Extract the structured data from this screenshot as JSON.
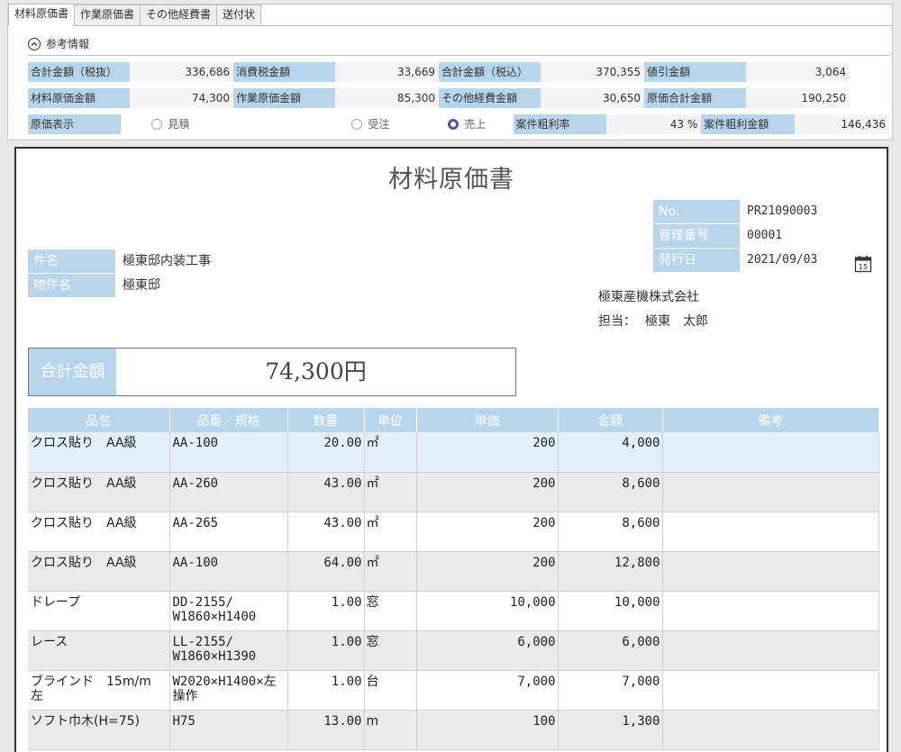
{
  "tabs": [
    "材料原価書",
    "作業原価書",
    "その他経費書",
    "送付状"
  ],
  "reference": {
    "title": "参考情報",
    "rows": [
      [
        {
          "label": "合計金額（税抜）",
          "value": "336,686"
        },
        {
          "label": "消費税金額",
          "value": "33,669"
        },
        {
          "label": "合計金額（税込）",
          "value": "370,355"
        },
        {
          "label": "値引金額",
          "value": "3,064"
        }
      ],
      [
        {
          "label": "材料原価金額",
          "value": "74,300"
        },
        {
          "label": "作業原価金額",
          "value": "85,300"
        },
        {
          "label": "その他経費金額",
          "value": "30,650"
        },
        {
          "label": "原価合計金額",
          "value": "190,250"
        }
      ]
    ],
    "cost_display_label": "原価表示",
    "cost_options": [
      {
        "label": "見積",
        "checked": false
      },
      {
        "label": "受注",
        "checked": false
      },
      {
        "label": "売上",
        "checked": true
      }
    ],
    "margin_rate_label": "案件粗利率",
    "margin_rate_value": "43 %",
    "margin_amount_label": "案件粗利金額",
    "margin_amount_value": "146,436"
  },
  "document": {
    "title": "材料原価書",
    "no_label": "No.",
    "no_value": "PR21090003",
    "mgmt_label": "管理番号",
    "mgmt_value": "00001",
    "date_label": "発行日",
    "date_value": "2021/09/03",
    "calendar_day": "15",
    "subject_label": "件名",
    "subject_value": "極東邸内装工事",
    "property_label": "物件名",
    "property_value": "極東邸",
    "company": "極東産機株式会社",
    "contact_label": "担当：",
    "contact_value": "極東　太郎",
    "total_label": "合計金額",
    "total_value": "74,300円"
  },
  "items": {
    "headers": [
      "品名",
      "品番／規格",
      "数量",
      "単位",
      "単価",
      "金額",
      "備考"
    ],
    "rows": [
      {
        "name": "クロス貼り　AA級",
        "spec": "AA-100",
        "qty": "20.00",
        "unit": "㎡",
        "price": "200",
        "amount": "4,000",
        "note": ""
      },
      {
        "name": "クロス貼り　AA級",
        "spec": "AA-260",
        "qty": "43.00",
        "unit": "㎡",
        "price": "200",
        "amount": "8,600",
        "note": ""
      },
      {
        "name": "クロス貼り　AA級",
        "spec": "AA-265",
        "qty": "43.00",
        "unit": "㎡",
        "price": "200",
        "amount": "8,600",
        "note": ""
      },
      {
        "name": "クロス貼り　AA級",
        "spec": "AA-100",
        "qty": "64.00",
        "unit": "㎡",
        "price": "200",
        "amount": "12,800",
        "note": ""
      },
      {
        "name": "ドレープ",
        "spec": "DD-2155/\nW1860×H1400",
        "qty": "1.00",
        "unit": "窓",
        "price": "10,000",
        "amount": "10,000",
        "note": ""
      },
      {
        "name": "レース",
        "spec": "LL-2155/\nW1860×H1390",
        "qty": "1.00",
        "unit": "窓",
        "price": "6,000",
        "amount": "6,000",
        "note": ""
      },
      {
        "name": "ブラインド　15m/m\n左",
        "spec": "W2020×H1400×左\n操作",
        "qty": "1.00",
        "unit": "台",
        "price": "7,000",
        "amount": "7,000",
        "note": ""
      },
      {
        "name": "ソフト巾木(H=75)",
        "spec": "H75",
        "qty": "13.00",
        "unit": "m",
        "price": "100",
        "amount": "1,300",
        "note": ""
      }
    ]
  }
}
